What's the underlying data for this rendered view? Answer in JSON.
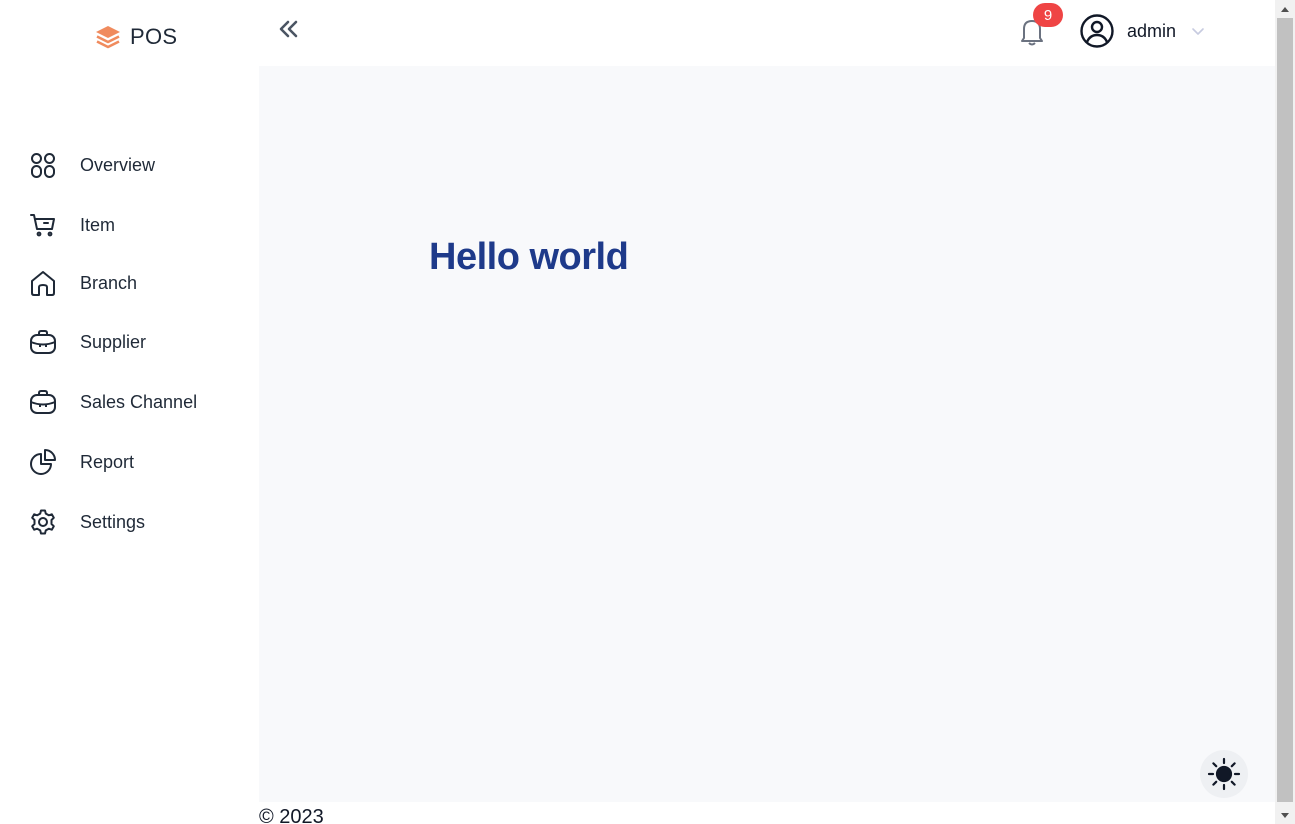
{
  "brand": {
    "name": "POS",
    "icon": "layers-icon",
    "icon_color": "#f08b5e"
  },
  "sidebar": {
    "items": [
      {
        "label": "Overview",
        "icon": "grid-icon"
      },
      {
        "label": "Item",
        "icon": "cart-icon"
      },
      {
        "label": "Branch",
        "icon": "home-icon"
      },
      {
        "label": "Supplier",
        "icon": "briefcase-icon"
      },
      {
        "label": "Sales Channel",
        "icon": "briefcase-icon"
      },
      {
        "label": "Report",
        "icon": "pie-chart-icon"
      },
      {
        "label": "Settings",
        "icon": "gear-icon"
      }
    ]
  },
  "topbar": {
    "collapse_icon": "double-chevron-left-icon",
    "notifications": {
      "icon": "bell-icon",
      "count": "9",
      "badge_color": "#ef4444"
    },
    "user": {
      "name": "admin",
      "icon": "user-circle-icon",
      "dropdown_icon": "chevron-down-icon"
    }
  },
  "main": {
    "heading": "Hello world",
    "heading_color": "#1e3a8a",
    "theme_toggle_icon": "sun-icon"
  },
  "footer": {
    "text": "© 2023"
  }
}
